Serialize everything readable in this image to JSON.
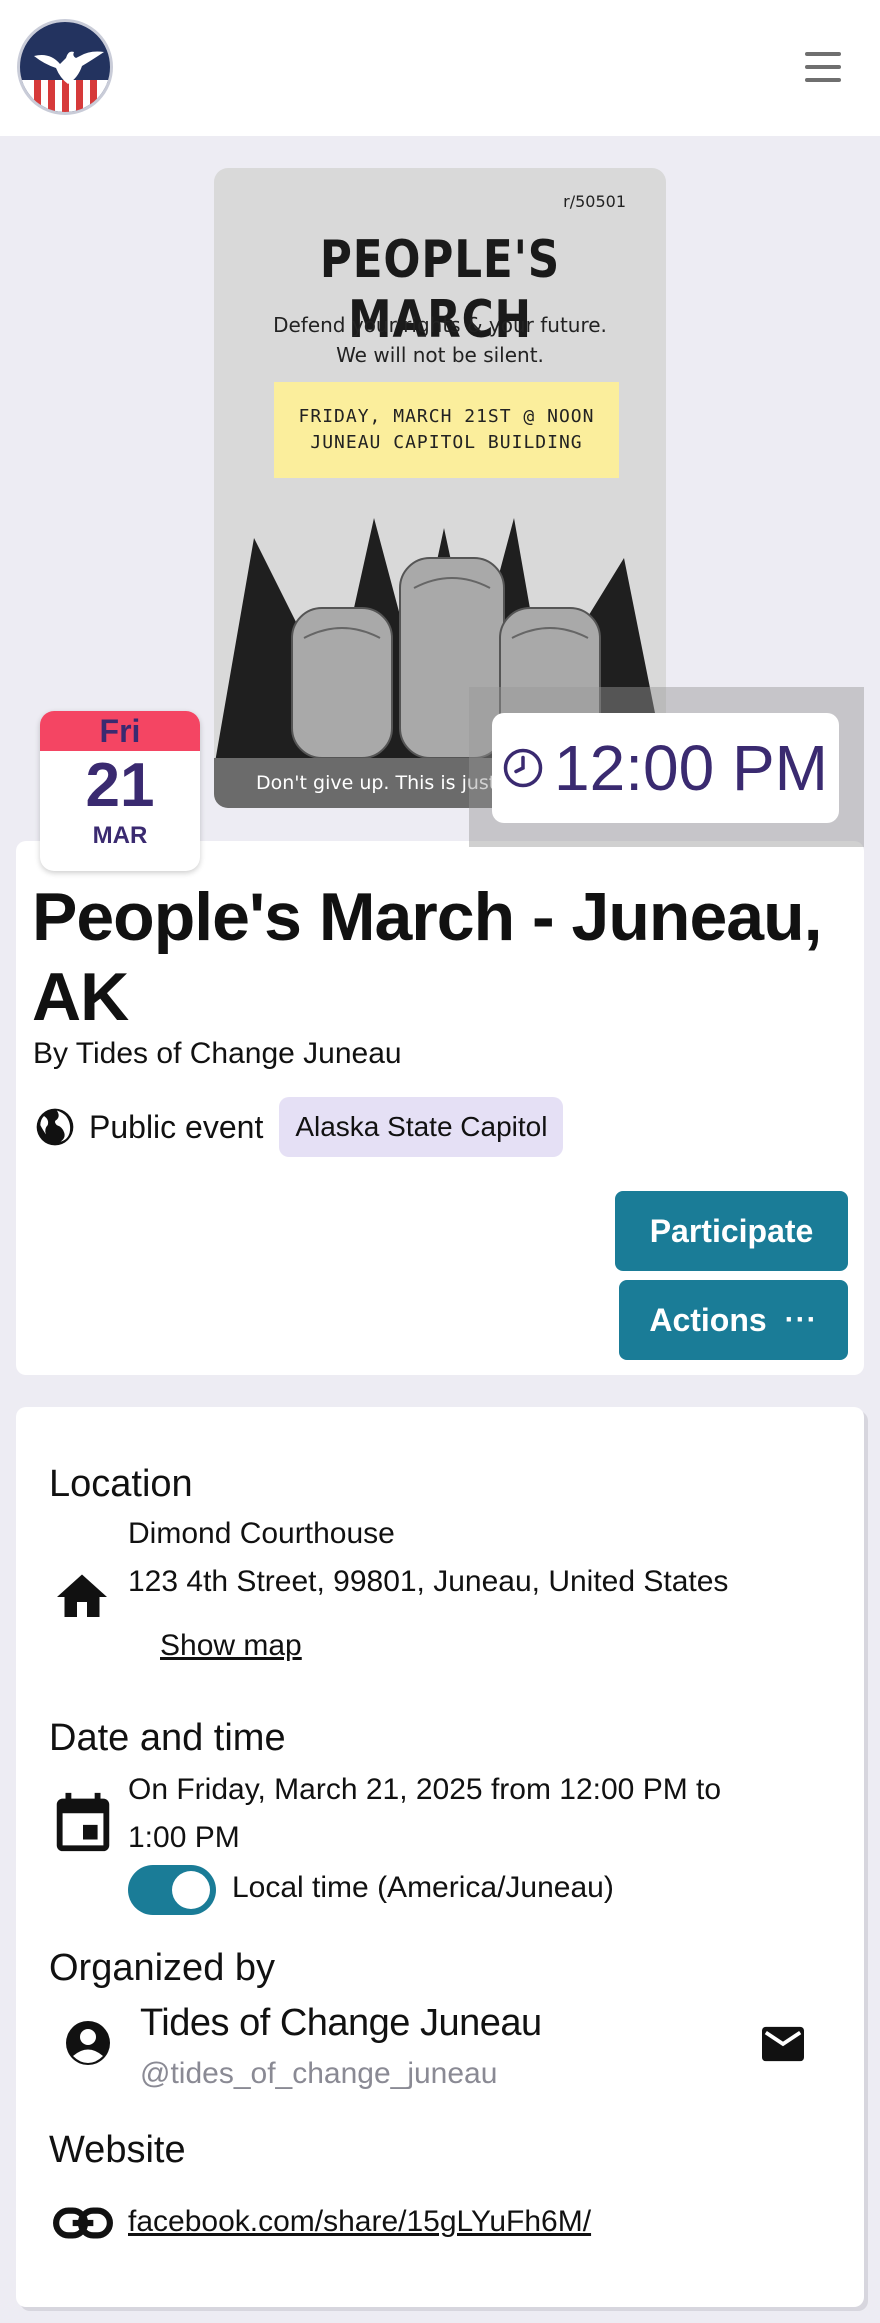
{
  "header": {
    "logo_icon": "eagle-flag-logo-icon",
    "menu_icon": "hamburger-menu-icon"
  },
  "poster": {
    "tag": "r/50501",
    "title": "PEOPLE'S MARCH",
    "subtitle_line1": "Defend your rights & your future.",
    "subtitle_line2": "We will not be silent.",
    "note_line1": "FRIDAY, MARCH 21ST @ NOON",
    "note_line2": "JUNEAU CAPITOL BUILDING",
    "footer": "Don't give up. This is just"
  },
  "date_badge": {
    "weekday": "Fri",
    "day": "21",
    "month": "MAR",
    "accent_color": "#f44563"
  },
  "time_badge": {
    "time": "12:00 PM",
    "icon": "clock-icon"
  },
  "event": {
    "title": "People's March - Juneau, AK",
    "byline": "By Tides of Change Juneau",
    "visibility": "Public event",
    "visibility_icon": "globe-icon",
    "place_tag": "Alaska State Capitol",
    "participate_label": "Participate",
    "actions_label": "Actions",
    "actions_icon": "more-dots-icon",
    "button_color": "#1a7c97"
  },
  "details": {
    "location_heading": "Location",
    "location_icon": "home-icon",
    "location_name": "Dimond Courthouse",
    "location_address": "123 4th Street, 99801, Juneau, United States",
    "show_map": "Show map",
    "datetime_heading": "Date and time",
    "datetime_icon": "calendar-icon",
    "datetime_line1": "On Friday, March 21, 2025 from 12:00 PM to",
    "datetime_line2": "1:00 PM",
    "local_time_label": "Local time (America/Juneau)",
    "local_time_enabled": true,
    "organizer_heading": "Organized by",
    "organizer_icon": "account-circle-icon",
    "organizer_name": "Tides of Change Juneau",
    "organizer_handle": "@tides_of_change_juneau",
    "contact_icon": "email-icon",
    "website_heading": "Website",
    "website_icon": "link-icon",
    "website_url": "facebook.com/share/15gLYuFh6M/"
  }
}
